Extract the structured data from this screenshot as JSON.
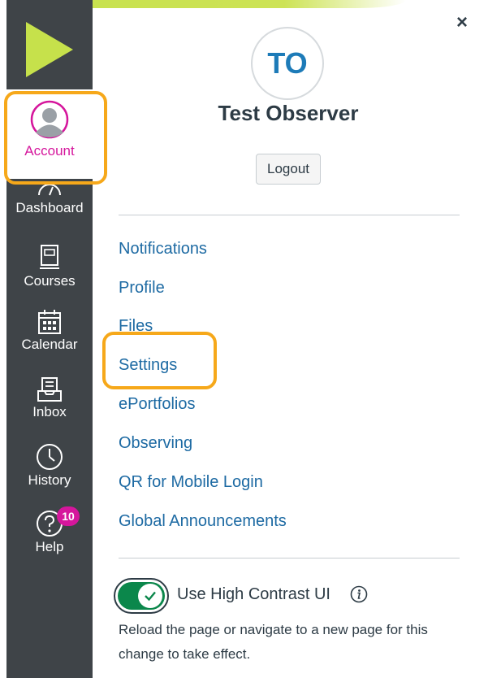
{
  "brand": {
    "accent_color": "#c6e14b",
    "sidebar_color": "#3f4448",
    "account_color": "#d5169c",
    "highlight_color": "#f6a81a",
    "link_color": "#1d6aa3"
  },
  "sidebar": {
    "logo_icon": "play-triangle-icon",
    "items": [
      {
        "label": "Account",
        "icon": "user-avatar-icon"
      },
      {
        "label": "Dashboard",
        "icon": "dashboard-icon"
      },
      {
        "label": "Courses",
        "icon": "book-icon"
      },
      {
        "label": "Calendar",
        "icon": "calendar-icon"
      },
      {
        "label": "Inbox",
        "icon": "inbox-icon"
      },
      {
        "label": "History",
        "icon": "clock-icon"
      },
      {
        "label": "Help",
        "icon": "help-icon"
      }
    ],
    "help_badge": "10"
  },
  "tray": {
    "close_label": "×",
    "avatar_initials": "TO",
    "user_name": "Test Observer",
    "logout_label": "Logout",
    "links": [
      "Notifications",
      "Profile",
      "Files",
      "Settings",
      "ePortfolios",
      "Observing",
      "QR for Mobile Login",
      "Global Announcements"
    ],
    "contrast_toggle": {
      "label": "Use High Contrast UI",
      "checked": true,
      "info_icon": "info-icon"
    },
    "note": "Reload the page or navigate to a new page for this change to take effect."
  }
}
